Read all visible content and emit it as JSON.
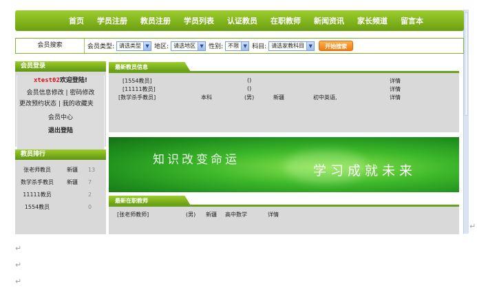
{
  "nav": [
    "首页",
    "学员注册",
    "教员注册",
    "学员列表",
    "认证教员",
    "在职教师",
    "新闻资讯",
    "家长频道",
    "留言本"
  ],
  "search": {
    "title": "会员搜索",
    "type_label": "会员类型:",
    "type_value": "请选类型",
    "region_label": "地区:",
    "region_value": "请选地区",
    "gender_label": "性别:",
    "gender_value": "不限",
    "subject_label": "科目:",
    "subject_value": "请选家教科目",
    "button": "开始搜索"
  },
  "login": {
    "header": "会员登录",
    "username": "xtest02",
    "welcome": "欢迎登陆!",
    "links1": "会员信息修改 | 密码修改",
    "links2": "更改预约状态 | 我的收藏夹",
    "center": "会员中心",
    "logout": "退出登陆"
  },
  "ranking": {
    "header": "教员排行",
    "rows": [
      {
        "name": "张老师教员",
        "area": "新疆",
        "count": "13"
      },
      {
        "name": "数学杀手教员",
        "area": "新疆",
        "count": "7"
      },
      {
        "name": "11111教员",
        "area": "",
        "count": "2"
      },
      {
        "name": "1554教员",
        "area": "",
        "count": "0"
      }
    ]
  },
  "latest_teachers": {
    "header": "最新教员信息",
    "rows": [
      {
        "name": "[1554教员]",
        "degree": "",
        "gender": "()",
        "area": "",
        "subject": "",
        "link": "详情"
      },
      {
        "name": "[11111教员]",
        "degree": "",
        "gender": "()",
        "area": "",
        "subject": "",
        "link": "详情"
      },
      {
        "name": "[数学杀手教员]",
        "degree": "本科",
        "gender": "(男)",
        "area": "新疆",
        "subject": "初中英语,",
        "link": "详情"
      }
    ]
  },
  "banner": {
    "left": "知识改变命运",
    "right": "学习成就未来"
  },
  "in_service": {
    "header": "最新在职教师",
    "rows": [
      {
        "name": "[张老师教师]",
        "gender": "(男)",
        "area": "新疆",
        "subject": "高中数学",
        "link": "详情"
      }
    ]
  },
  "doc_marks": [
    "↵",
    "↵",
    "↵",
    "↵"
  ],
  "colors": {
    "nav_green": "#7cb41c",
    "accent_orange": "#f07a10",
    "username_red": "#e01010"
  }
}
